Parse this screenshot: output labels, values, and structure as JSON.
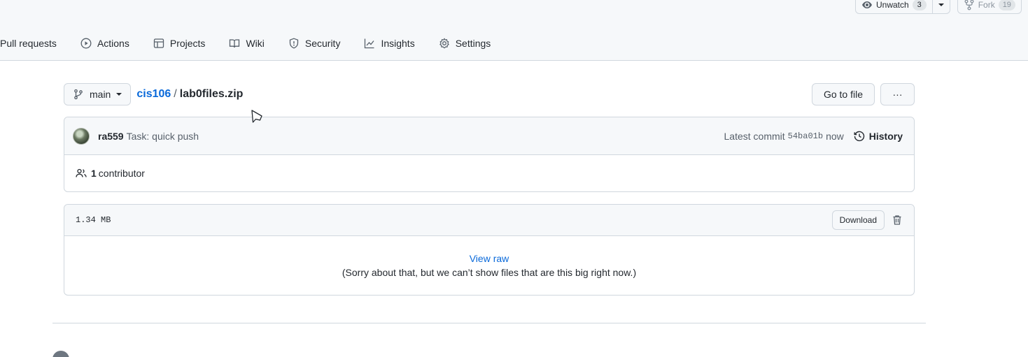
{
  "header": {
    "watch": {
      "label": "Unwatch",
      "count": "3"
    },
    "fork": {
      "label": "Fork",
      "count": "19"
    },
    "tabs": [
      {
        "label": "Pull requests",
        "icon": "pull-request-icon"
      },
      {
        "label": "Actions",
        "icon": "play-icon"
      },
      {
        "label": "Projects",
        "icon": "table-icon"
      },
      {
        "label": "Wiki",
        "icon": "book-icon"
      },
      {
        "label": "Security",
        "icon": "shield-icon"
      },
      {
        "label": "Insights",
        "icon": "graph-icon"
      },
      {
        "label": "Settings",
        "icon": "gear-icon"
      }
    ]
  },
  "file_nav": {
    "branch": "main",
    "repo": "cis106",
    "separator": "/",
    "filename": "lab0files.zip",
    "go_to_file": "Go to file",
    "more": "···"
  },
  "commit": {
    "author": "ra559",
    "message": "Task: quick push",
    "latest_label": "Latest commit",
    "sha": "54ba01b",
    "time": "now",
    "history": "History"
  },
  "contributors": {
    "count": "1",
    "label": "contributor"
  },
  "file": {
    "size": "1.34 MB",
    "download": "Download",
    "view_raw": "View raw",
    "too_big": "(Sorry about that, but we can’t show files that are this big right now.)"
  },
  "colors": {
    "link": "#0969da",
    "border": "#d0d7de",
    "header_bg": "#f6f8fa"
  }
}
